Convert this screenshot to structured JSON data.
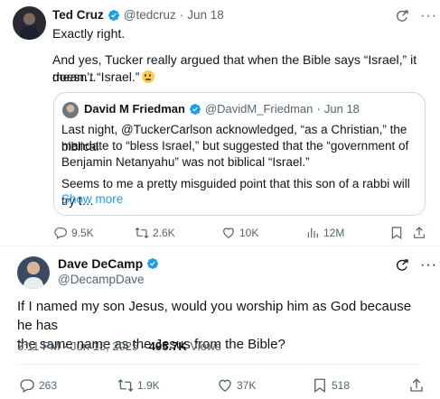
{
  "tweet1": {
    "author_name": "Ted Cruz",
    "author_handle": "@tedcruz",
    "date": "Jun 18",
    "line1": "Exactly right.",
    "line2": "And yes, Tucker really argued that when the Bible says “Israel,” it doesn’t",
    "line3": "mean…“Israel.”",
    "emoji": "thinking-face-emoji",
    "quote": {
      "author_name": "David M Friedman",
      "author_handle": "@DavidM_Friedman",
      "date": "Jun 18",
      "p1_line1": "Last night, @TuckerCarlson acknowledged, “as a Christian,” the biblical",
      "p1_line2": "mandate to “bless Israel,” but suggested that the “government of",
      "p1_line3": "Benjamin Netanyahu” was not biblical  “Israel.”",
      "p2_line1": "Seems to me a pretty misguided point that this son of a rabbi will try t…",
      "show_more": "Show more"
    },
    "stats": {
      "replies": "9.5K",
      "reposts": "2.6K",
      "likes": "10K",
      "views": "12M"
    }
  },
  "tweet2": {
    "author_name": "Dave DeCamp",
    "author_handle": "@DecampDave",
    "text_line1": "If I named my son Jesus, would you worship him as God because he has",
    "text_line2": "the same name as the Jesus from the Bible?",
    "time": "3:11 PM",
    "date": "Jun 18, 2025",
    "views_count": "495.7K",
    "views_label": "Views",
    "stats": {
      "replies": "263",
      "reposts": "1.9K",
      "likes": "37K",
      "bookmarks": "518"
    }
  },
  "colors": {
    "accent": "#1d9bf0",
    "secondary_text": "#536471",
    "border": "#cfd9de"
  },
  "icons": [
    "verified-badge-icon",
    "grok-icon",
    "more-icon",
    "reply-icon",
    "repost-icon",
    "like-icon",
    "views-icon",
    "bookmark-icon",
    "share-icon"
  ]
}
